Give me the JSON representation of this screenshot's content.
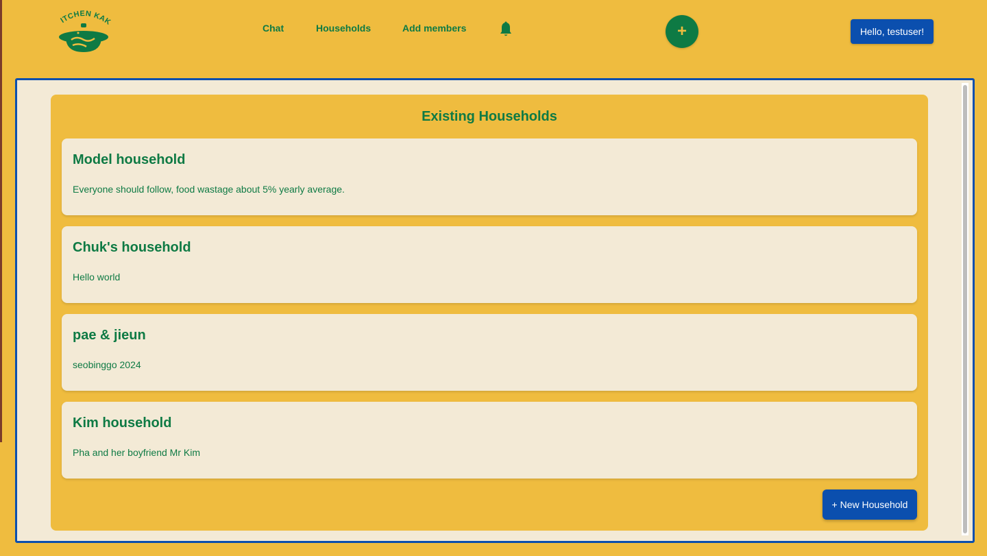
{
  "app": {
    "logo_text": "KITCHEN KAKI",
    "brand_green": "#0E7A44",
    "brand_yellow": "#EFBC3F",
    "brand_blue": "#0B4FAE",
    "cream": "#F3EAD6"
  },
  "header": {
    "nav": [
      {
        "label": "Chat"
      },
      {
        "label": "Households"
      },
      {
        "label": "Add members"
      }
    ],
    "notifications_icon": "bell-icon",
    "fab_label": "+",
    "user_button_label": "Hello, testuser!"
  },
  "main": {
    "title": "Existing Households",
    "households": [
      {
        "name": "Model household",
        "description": "Everyone should follow, food wastage about 5% yearly average."
      },
      {
        "name": "Chuk's household",
        "description": "Hello world"
      },
      {
        "name": "pae & jieun",
        "description": "seobinggo 2024"
      },
      {
        "name": "Kim household",
        "description": "Pha and her boyfriend Mr Kim"
      }
    ],
    "new_household_label": "+ New Household"
  }
}
